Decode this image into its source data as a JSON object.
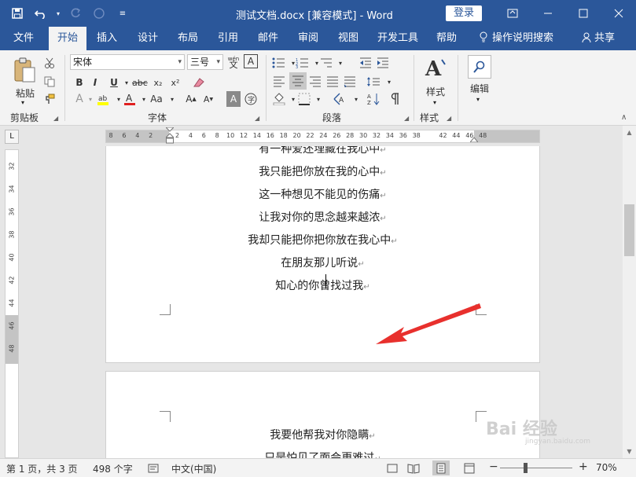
{
  "titlebar": {
    "title": "测试文档.docx [兼容模式]  -  Word",
    "login": "登录",
    "qat_icons": [
      "save-icon",
      "undo-icon",
      "redo-icon",
      "circle-icon",
      "customize-icon"
    ]
  },
  "tabs": [
    {
      "label": "文件"
    },
    {
      "label": "开始"
    },
    {
      "label": "插入"
    },
    {
      "label": "设计"
    },
    {
      "label": "布局"
    },
    {
      "label": "引用"
    },
    {
      "label": "邮件"
    },
    {
      "label": "审阅"
    },
    {
      "label": "视图"
    },
    {
      "label": "开发工具"
    },
    {
      "label": "帮助"
    }
  ],
  "tell_me": "操作说明搜索",
  "share": "共享",
  "ribbon": {
    "clipboard": {
      "paste": "粘贴",
      "label": "剪贴板"
    },
    "font": {
      "name": "宋体",
      "size": "三号",
      "label": "字体",
      "wen": "wén",
      "wen_char": "文",
      "a_box": "A"
    },
    "paragraph": {
      "label": "段落"
    },
    "styles": {
      "button": "样式",
      "label": "样式"
    },
    "editing": {
      "button": "编辑"
    }
  },
  "ruler": {
    "ticks": [
      "8",
      "6",
      "4",
      "2",
      "",
      "2",
      "4",
      "6",
      "8",
      "10",
      "12",
      "14",
      "16",
      "18",
      "20",
      "22",
      "24",
      "26",
      "28",
      "30",
      "32",
      "34",
      "36",
      "38",
      "",
      "42",
      "44",
      "46",
      "48"
    ],
    "vticks": [
      "32",
      "34",
      "36",
      "38",
      "40",
      "42",
      "44",
      "46",
      "48"
    ],
    "corner": "L"
  },
  "document": {
    "page1_lines": [
      "有一种爱还埋藏在我心中",
      "我只能把你放在我的心中",
      "这一种想见不能见的伤痛",
      "让我对你的思念越来越浓",
      "我却只能把你把你放在我心中",
      "在朋友那儿听说",
      "知心的你曾找过我"
    ],
    "page2_lines": [
      "我要他帮我对你隐瞒",
      "只是怕见了面会更难过"
    ],
    "para_mark": "↵"
  },
  "statusbar": {
    "page": "第 1 页，共 3 页",
    "words": "498 个字",
    "lang": "中文(中国)",
    "zoom_minus": "−",
    "zoom_plus": "+",
    "zoom": "70%"
  },
  "watermark": {
    "text": "Bai 经验",
    "sub": "jingyan.baidu.com"
  },
  "colors": {
    "title_bg": "#2b579a",
    "arrow": "#e8302d"
  }
}
